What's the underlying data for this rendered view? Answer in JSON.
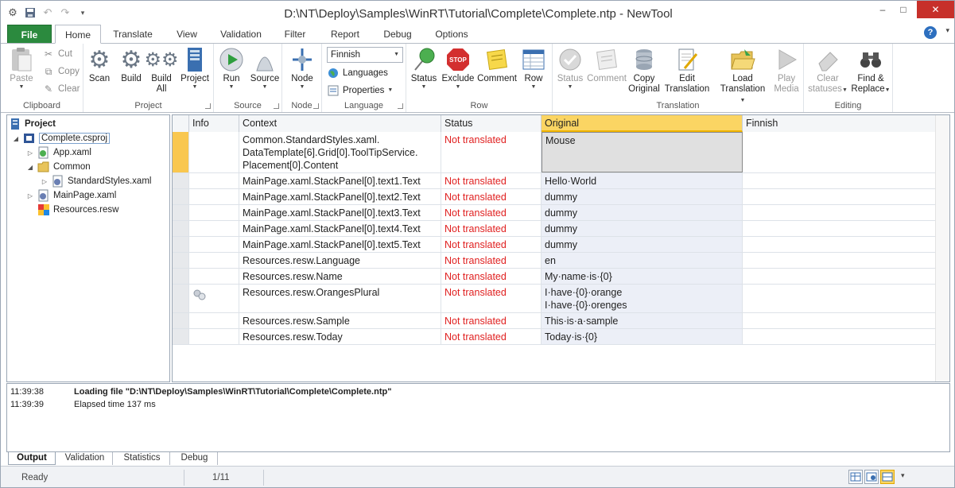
{
  "window": {
    "title": "D:\\NT\\Deploy\\Samples\\WinRT\\Tutorial\\Complete\\Complete.ntp - NewTool",
    "minimize": "–",
    "maximize": "□",
    "close": "✕"
  },
  "qat": {
    "icons": [
      "gear-icon",
      "save-icon",
      "undo-icon",
      "redo-icon",
      "customize-icon"
    ]
  },
  "tabs": [
    {
      "label": "File"
    },
    {
      "label": "Home"
    },
    {
      "label": "Translate"
    },
    {
      "label": "View"
    },
    {
      "label": "Validation"
    },
    {
      "label": "Filter"
    },
    {
      "label": "Report"
    },
    {
      "label": "Debug"
    },
    {
      "label": "Options"
    }
  ],
  "help": "?",
  "ribbon": {
    "clipboard": {
      "label": "Clipboard",
      "paste": "Paste",
      "cut": "Cut",
      "copy": "Copy",
      "clear": "Clear"
    },
    "project": {
      "label": "Project",
      "scan": "Scan",
      "build": "Build",
      "build_all_1": "Build",
      "build_all_2": "All",
      "project": "Project"
    },
    "source": {
      "label": "Source",
      "run": "Run",
      "source": "Source"
    },
    "node": {
      "label": "Node",
      "node": "Node"
    },
    "language": {
      "label": "Language",
      "selected": "Finnish",
      "languages": "Languages",
      "properties": "Properties"
    },
    "row": {
      "label": "Row",
      "status": "Status",
      "exclude": "Exclude",
      "comment": "Comment",
      "row": "Row"
    },
    "translation": {
      "label": "Translation",
      "status": "Status",
      "comment": "Comment",
      "copy_1": "Copy",
      "copy_2": "Original",
      "edit_1": "Edit",
      "edit_2": "Translation",
      "load_1": "Load",
      "load_2": "Translation",
      "play_1": "Play",
      "play_2": "Media"
    },
    "editing": {
      "label": "Editing",
      "clear_1": "Clear",
      "clear_2": "statuses",
      "find_1": "Find &",
      "find_2": "Replace"
    }
  },
  "tree": {
    "items": [
      {
        "label": "Project",
        "icon": "project-icon"
      },
      {
        "label": "Complete.csproj",
        "icon": "csproj-icon"
      },
      {
        "label": "App.xaml",
        "icon": "xaml-icon"
      },
      {
        "label": "Common",
        "icon": "folder-icon"
      },
      {
        "label": "StandardStyles.xaml",
        "icon": "xaml-icon"
      },
      {
        "label": "MainPage.xaml",
        "icon": "xaml-icon"
      },
      {
        "label": "Resources.resw",
        "icon": "resw-icon"
      }
    ]
  },
  "grid": {
    "columns": [
      "Info",
      "Context",
      "Status",
      "Original",
      "Finnish"
    ],
    "rows": [
      {
        "context_1": "Common.StandardStyles.xaml.",
        "context_2": "DataTemplate[6].Grid[0].ToolTipService.",
        "context_3": "Placement[0].Content",
        "status": "Not translated",
        "original": "Mouse",
        "finnish": ""
      },
      {
        "context": "MainPage.xaml.StackPanel[0].text1.Text",
        "status": "Not translated",
        "original": "Hello·World",
        "finnish": ""
      },
      {
        "context": "MainPage.xaml.StackPanel[0].text2.Text",
        "status": "Not translated",
        "original": "dummy",
        "finnish": ""
      },
      {
        "context": "MainPage.xaml.StackPanel[0].text3.Text",
        "status": "Not translated",
        "original": "dummy",
        "finnish": ""
      },
      {
        "context": "MainPage.xaml.StackPanel[0].text4.Text",
        "status": "Not translated",
        "original": "dummy",
        "finnish": ""
      },
      {
        "context": "MainPage.xaml.StackPanel[0].text5.Text",
        "status": "Not translated",
        "original": "dummy",
        "finnish": ""
      },
      {
        "context": "Resources.resw.Language",
        "status": "Not translated",
        "original": "en",
        "finnish": ""
      },
      {
        "context": "Resources.resw.Name",
        "status": "Not translated",
        "original": "My·name·is·{0}",
        "finnish": ""
      },
      {
        "context": "Resources.resw.OrangesPlural",
        "status": "Not translated",
        "original_1": "I·have·{0}·orange",
        "original_2": "I·have·{0}·orenges",
        "finnish": ""
      },
      {
        "context": "Resources.resw.Sample",
        "status": "Not translated",
        "original": "This·is·a·sample",
        "finnish": ""
      },
      {
        "context": "Resources.resw.Today",
        "status": "Not translated",
        "original": "Today·is·{0}",
        "finnish": ""
      }
    ]
  },
  "output": {
    "lines": [
      {
        "time": "11:39:38",
        "message": "Loading file \"D:\\NT\\Deploy\\Samples\\WinRT\\Tutorial\\Complete\\Complete.ntp\""
      },
      {
        "time": "11:39:39",
        "message": "Elapsed time 137 ms"
      }
    ],
    "tabs": [
      "Output",
      "Validation",
      "Statistics",
      "Debug"
    ]
  },
  "statusbar": {
    "state": "Ready",
    "position": "1/11"
  },
  "colors": {
    "file_tab": "#2b8a3e",
    "status_red": "#e02020",
    "highlight": "#fbd563"
  }
}
